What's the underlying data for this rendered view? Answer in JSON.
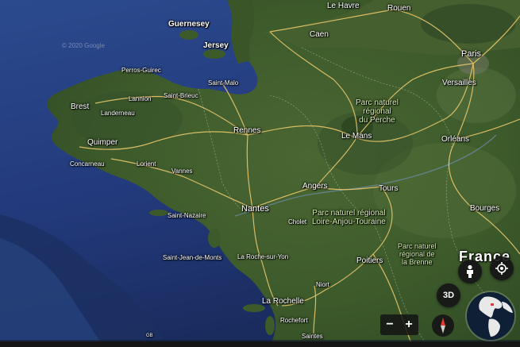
{
  "copyright": "© 2020 Google",
  "scale": "GB",
  "labels": {
    "le_havre": "Le Havre",
    "rouen": "Rouen",
    "guernesey": "Guernesey",
    "jersey": "Jersey",
    "caen": "Caen",
    "paris": "Paris",
    "versailles": "Versailles",
    "perros_guirec": "Perros-Guirec",
    "lannion": "Lannion",
    "saint_malo": "Saint-Malo",
    "brest": "Brest",
    "landerneau": "Landerneau",
    "saint_brieuc": "Saint-Brieuc",
    "rennes": "Rennes",
    "quimper": "Quimper",
    "concarneau": "Concarneau",
    "lorient": "Lorient",
    "vannes": "Vannes",
    "le_mans": "Le Mans",
    "orleans": "Orléans",
    "angers": "Angers",
    "tours": "Tours",
    "nantes": "Nantes",
    "cholet": "Cholet",
    "saint_nazaire": "Saint-Nazaire",
    "bourges": "Bourges",
    "saint_jean_de_monts": "Saint-Jean-de-Monts",
    "la_roche_sur_yon": "La Roche-sur-Yon",
    "poitiers": "Poitiers",
    "niort": "Niort",
    "la_rochelle": "La Rochelle",
    "rochefort": "Rochefort",
    "saintes": "Saintes",
    "france": "France",
    "park_perche": [
      "Parc naturel",
      "régional",
      "du Perche"
    ],
    "park_loire": [
      "Parc naturel régional",
      "Loire-Anjou-Touraine"
    ],
    "park_brenne": [
      "Parc naturel",
      "régional de",
      "la Brenne"
    ]
  },
  "controls": {
    "pegman_icon": "person-icon",
    "locate_icon": "my-location-icon",
    "view_3d_label": "3D",
    "zoom_out_label": "−",
    "zoom_in_label": "+",
    "compass_icon": "compass-icon",
    "globe_icon": "globe-icon"
  },
  "colors": {
    "sea": "#2a4a8c",
    "land": "#3e5a2c",
    "road": "#e8c76a",
    "border": "#ffffff"
  }
}
